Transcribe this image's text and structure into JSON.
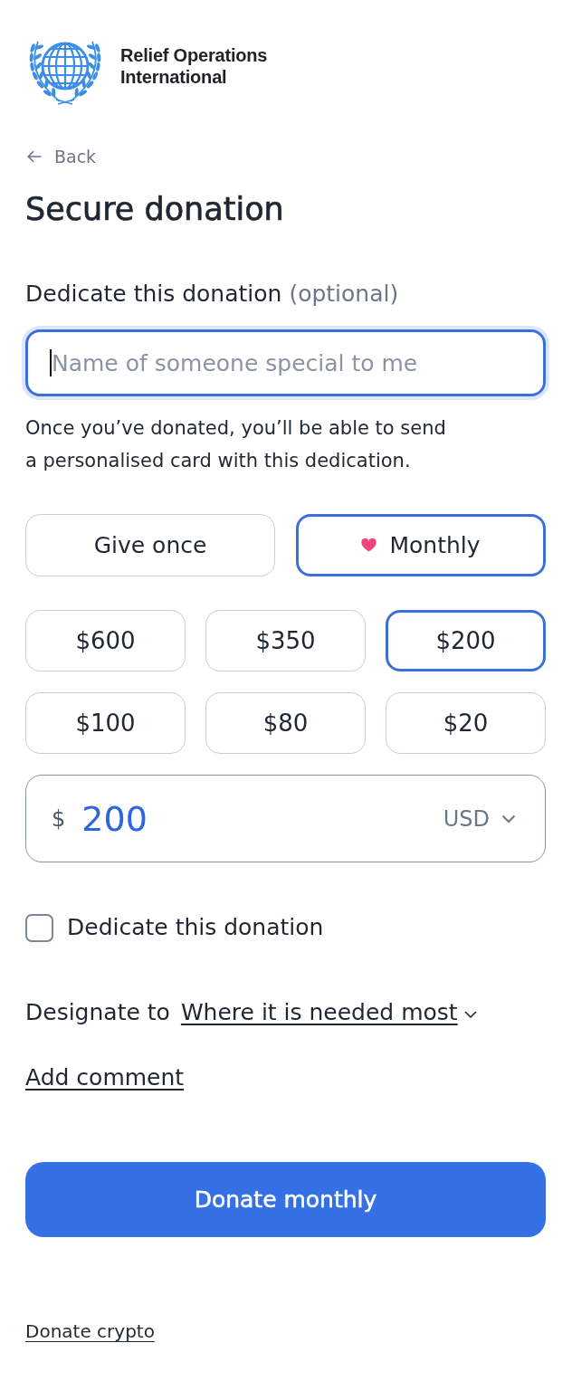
{
  "brand": {
    "name_lines": [
      "Relief Operations",
      "International"
    ]
  },
  "back_link": {
    "label": "Back"
  },
  "title": "Secure donation",
  "dedication": {
    "label": "Dedicate this donation",
    "hint": "(optional)",
    "placeholder": "Name of someone special to me",
    "focused": true,
    "help_text": "Once you’ve donated, you’ll be able to send a personalised card with this dedication."
  },
  "frequency": [
    {
      "label": "Give once",
      "kind": "one_time",
      "selected": false
    },
    {
      "label": "Monthly",
      "kind": "recurring",
      "selected": true
    }
  ],
  "amounts": [
    {
      "label": "$600",
      "selected": false
    },
    {
      "label": "$350",
      "selected": false
    },
    {
      "label": "$200",
      "selected": true
    },
    {
      "label": "$100",
      "selected": false
    },
    {
      "label": "$80",
      "selected": false
    },
    {
      "label": "$20",
      "selected": false
    }
  ],
  "amount_field": {
    "currency_symbol": "$",
    "value": "200",
    "currency": "USD"
  },
  "dedicate_checkbox": {
    "label": "Dedicate this donation",
    "checked": false
  },
  "designation": {
    "label": "Designate to",
    "value": "Where it is needed most"
  },
  "add_comment": {
    "label": "Add comment"
  },
  "submit": {
    "label": "Donate monthly"
  },
  "crypto_link": {
    "label": "Donate crypto"
  }
}
